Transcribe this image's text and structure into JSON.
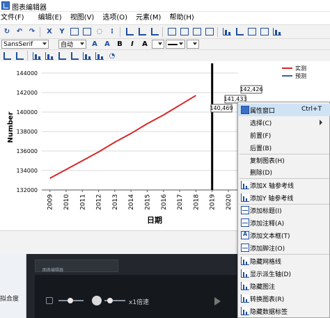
{
  "window": {
    "title": "图表编辑器"
  },
  "menubar": [
    "文件(F)",
    "编辑(E)",
    "视图(V)",
    "选项(O)",
    "元素(M)",
    "帮助(H)"
  ],
  "toolbar_font": {
    "font_name": "SansSerif",
    "font_size": "自动",
    "bold": "B",
    "italic": "I",
    "text_color": "A",
    "grow_font": "A",
    "shrink_font": "A"
  },
  "toolbar_main": {
    "close_label": "X",
    "y_label": "Y"
  },
  "chart_data": {
    "type": "line",
    "x": [
      2009,
      2010,
      2011,
      2012,
      2013,
      2014,
      2015,
      2016,
      2017,
      2018
    ],
    "series": [
      {
        "name": "实测",
        "color": "#d62728",
        "values": [
          133200,
          134100,
          135000,
          135900,
          136900,
          137800,
          138800,
          139700,
          140700,
          141700
        ]
      },
      {
        "name": "预测",
        "color": "#3b5bab",
        "values": []
      }
    ],
    "xticks": [
      "2009",
      "2010",
      "2011",
      "2012",
      "2013",
      "2014",
      "2015",
      "2016",
      "2017",
      "2018",
      "2019",
      "2020"
    ],
    "yticks": [
      "132000",
      "134000",
      "136000",
      "138000",
      "140000",
      "142000",
      "144000"
    ],
    "xlabel": "日期",
    "ylabel": "Number",
    "ylim": [
      132000,
      145000
    ],
    "xlim": [
      2008.5,
      2020.6
    ],
    "reference_line_x": 2019,
    "data_labels": [
      "142,426",
      "141,433",
      "140,469"
    ],
    "legend_position": "top-right",
    "grid": "horizontal"
  },
  "context_menu": {
    "items": [
      {
        "label": "属性窗口",
        "shortcut": "Ctrl+T",
        "icon": "properties-icon"
      },
      {
        "label": "选择(C)",
        "submenu": true
      },
      {
        "label": "前置(F)"
      },
      {
        "label": "后置(B)"
      },
      {
        "label": "复制图表(H)"
      },
      {
        "label": "删除(D)"
      },
      {
        "label": "添加X 轴参考线",
        "icon": "x-reference-line-icon"
      },
      {
        "label": "添加Y 轴参考线",
        "icon": "y-reference-line-icon"
      },
      {
        "label": "添加标题(I)",
        "icon": "title-icon"
      },
      {
        "label": "添加注释(A)",
        "icon": "annotation-icon"
      },
      {
        "label": "添加文本框(T)",
        "icon": "textbox-icon"
      },
      {
        "label": "添加脚注(O)",
        "icon": "footnote-icon"
      },
      {
        "label": "隐藏网格线",
        "icon": "gridlines-icon"
      },
      {
        "label": "显示派生轴(D)",
        "icon": "derived-axis-icon"
      },
      {
        "label": "隐藏图注",
        "icon": "legend-icon"
      },
      {
        "label": "转换图表(R)",
        "icon": "transpose-icon"
      },
      {
        "label": "隐藏数据标签",
        "icon": "data-labels-icon"
      }
    ]
  },
  "background": {
    "left_label": "拟合度",
    "video_speed": "x1倍速",
    "video_caption": "图表编辑器"
  }
}
